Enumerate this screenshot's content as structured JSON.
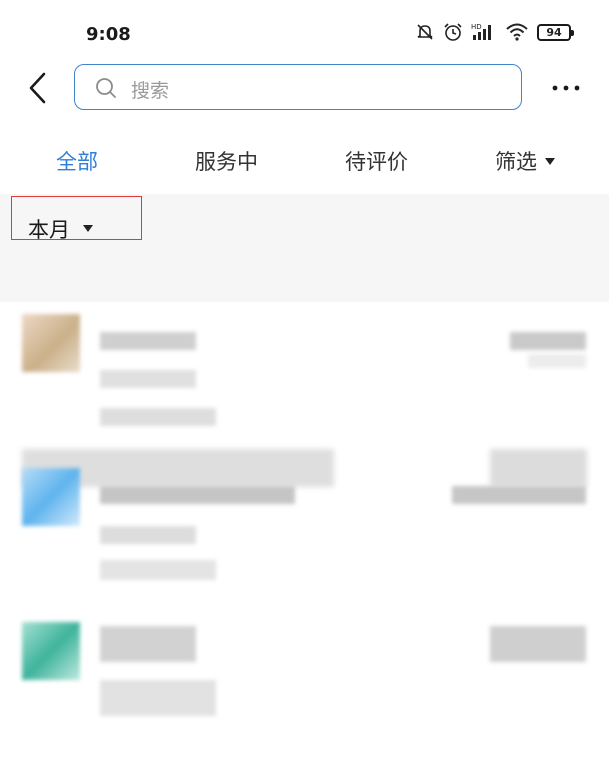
{
  "status_bar": {
    "time": "9:08",
    "battery": "94"
  },
  "header": {
    "search_placeholder": "搜索"
  },
  "tabs": [
    {
      "label": "全部",
      "active": true
    },
    {
      "label": "服务中",
      "active": false
    },
    {
      "label": "待评价",
      "active": false
    },
    {
      "label": "筛选",
      "active": false,
      "dropdown": true
    }
  ],
  "filter": {
    "month_label": "本月"
  },
  "colors": {
    "accent": "#2f7ed8",
    "highlight_border": "#e0393b",
    "search_border": "#3f85c7"
  },
  "icons": [
    "back-chevron-icon",
    "search-icon",
    "more-icon",
    "caret-down-icon",
    "wifi-icon",
    "signal-icon",
    "alarm-icon",
    "mute-icon"
  ]
}
